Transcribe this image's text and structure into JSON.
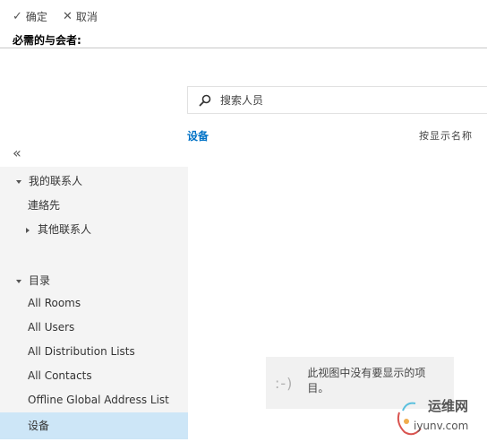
{
  "toolbar": {
    "ok_label": "确定",
    "cancel_label": "取消"
  },
  "page_title": "必需的与会者:",
  "search": {
    "placeholder": "搜索人员"
  },
  "list_header": {
    "folder_label": "设备",
    "sort_label": "按显示名称"
  },
  "collapse_glyph": "«",
  "tree": {
    "my_contacts": "我的联系人",
    "contacts": "連絡先",
    "other_contacts": "其他联系人",
    "directory": "目录",
    "directory_items": [
      "All Rooms",
      "All Users",
      "All Distribution Lists",
      "All Contacts",
      "Offline Global Address List",
      "设备"
    ]
  },
  "empty_state": {
    "face": ":-)",
    "message": "此视图中没有要显示的项目。"
  },
  "watermark": {
    "brand": "运维网",
    "url": "iyunv.com"
  }
}
